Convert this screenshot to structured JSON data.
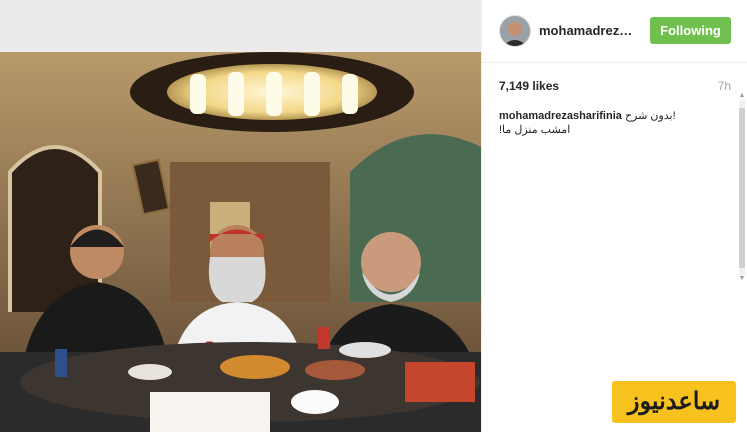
{
  "post": {
    "username": "mohamadrezas...",
    "follow_label": "Following",
    "likes": "7,149 likes",
    "time": "7h"
  },
  "caption": {
    "username": "mohamadrezasharifinia",
    "line1_text": "بدون شرح!",
    "line2_text": "امشب منزل ما!"
  },
  "photo": {
    "alt_subject": "three men at dinner table"
  },
  "watermark": {
    "text": "ساعدنیوز"
  },
  "colors": {
    "follow_button": "#70c050",
    "watermark": "#f7c21e",
    "time": "#a5a7aa"
  },
  "icons": [
    "avatar",
    "scroll-up-icon",
    "scroll-down-icon"
  ]
}
